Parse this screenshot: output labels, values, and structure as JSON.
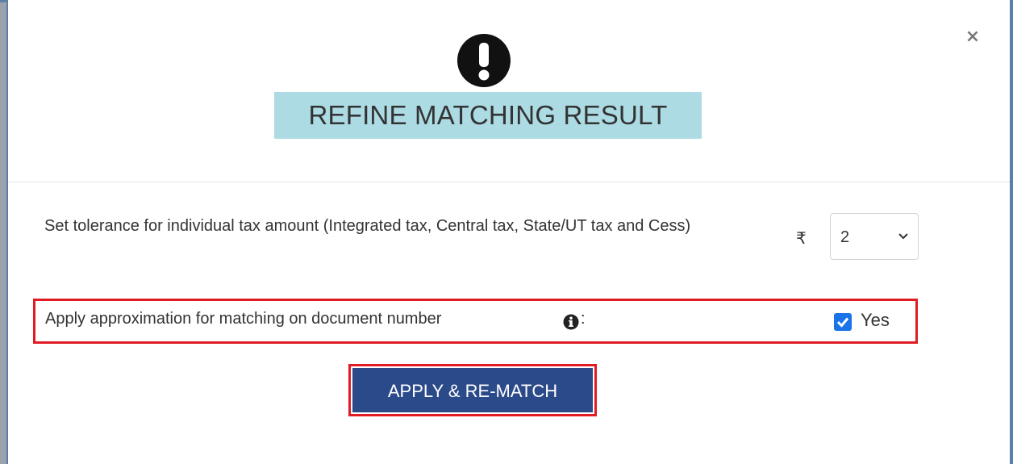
{
  "dialog": {
    "close_label": "×",
    "icon": "exclamation-circle-icon",
    "title": "REFINE MATCHING RESULT"
  },
  "tolerance": {
    "label": "Set tolerance for individual tax amount (Integrated tax, Central tax, State/UT tax and Cess)",
    "currency_symbol": "₹",
    "selected_value": "2"
  },
  "approximation": {
    "label": "Apply approximation for matching on document number",
    "info_icon": "info-circle-icon",
    "colon": ":",
    "checkbox_checked": true,
    "checkbox_label": "Yes"
  },
  "actions": {
    "apply_label": "APPLY & RE-MATCH"
  },
  "colors": {
    "title_highlight": "#acdbe4",
    "primary_button": "#2b4a8a",
    "checkbox": "#1a73e8",
    "annotation_outline": "#e01b24"
  }
}
